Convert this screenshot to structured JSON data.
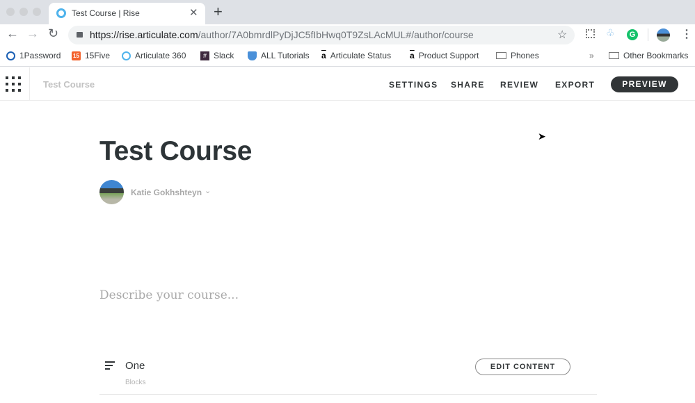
{
  "browser": {
    "tab_title": "Test Course | Rise",
    "url_host": "https://rise.articulate.com",
    "url_path": "/author/7A0bmrdlPyDjJC5fIbHwq0T9ZsLAcMUL#/author/course",
    "bookmarks": [
      "1Password",
      "15Five",
      "Articulate 360",
      "Slack",
      "ALL Tutorials",
      "Articulate Status",
      "Product Support",
      "Phones"
    ],
    "other_bookmarks": "Other Bookmarks",
    "overflow": "»",
    "fivebadge": "15"
  },
  "app": {
    "course_title": "Test Course",
    "nav": [
      "SETTINGS",
      "SHARE",
      "REVIEW",
      "EXPORT"
    ],
    "preview": "PREVIEW"
  },
  "main": {
    "title": "Test Course",
    "author": "Katie Gokhshteyn",
    "description_placeholder": "Describe your course...",
    "lessons": [
      {
        "title": "One",
        "type": "Blocks",
        "action": "EDIT CONTENT"
      }
    ]
  }
}
